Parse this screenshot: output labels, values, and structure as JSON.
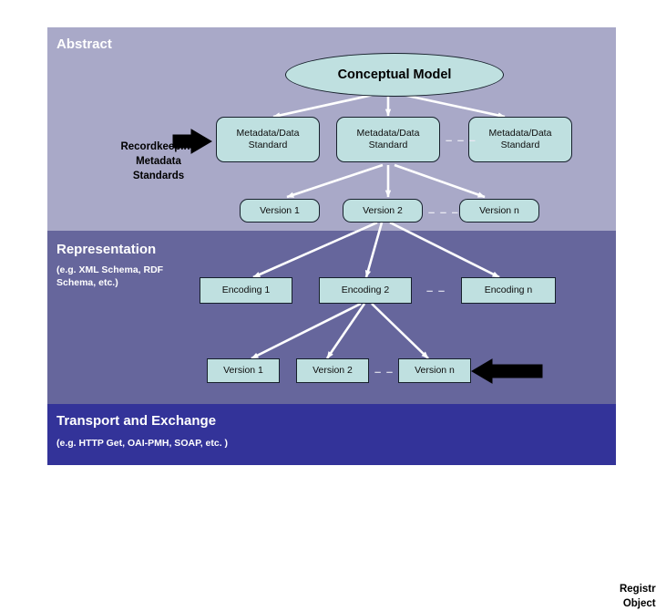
{
  "bands": {
    "abstract": {
      "title": "Abstract",
      "color": "#a9a9c8"
    },
    "representation": {
      "title": "Representation",
      "subtitle": "(e.g. XML Schema, RDF\nSchema, etc.)",
      "color": "#66669c"
    },
    "transport": {
      "title": "Transport and Exchange",
      "subtitle": "(e.g. HTTP Get, OAI-PMH, SOAP, etc. )",
      "color": "#333399"
    }
  },
  "side_labels": {
    "recordkeeping": "Recordkeeping\nMetadata\nStandards",
    "registry": "Registry\nObjects"
  },
  "conceptual_model": {
    "label": "Conceptual Model"
  },
  "standards": [
    {
      "label": "Metadata/Data\nStandard"
    },
    {
      "label": "Metadata/Data\nStandard"
    },
    {
      "label": "Metadata/Data\nStandard"
    }
  ],
  "standard_versions": [
    {
      "label": "Version 1"
    },
    {
      "label": "Version 2"
    },
    {
      "label": "Version n"
    }
  ],
  "encodings": [
    {
      "label": "Encoding 1"
    },
    {
      "label": "Encoding 2"
    },
    {
      "label": "Encoding n"
    }
  ],
  "encoding_versions": [
    {
      "label": "Version 1"
    },
    {
      "label": "Version 2"
    },
    {
      "label": "Version n"
    }
  ],
  "ellipsis": {
    "long": "– – –",
    "short": "– –"
  },
  "colors": {
    "node_fill": "#bfe0e0",
    "node_border": "#16202b",
    "connector": "#ffffff",
    "arrow_black": "#000000"
  }
}
